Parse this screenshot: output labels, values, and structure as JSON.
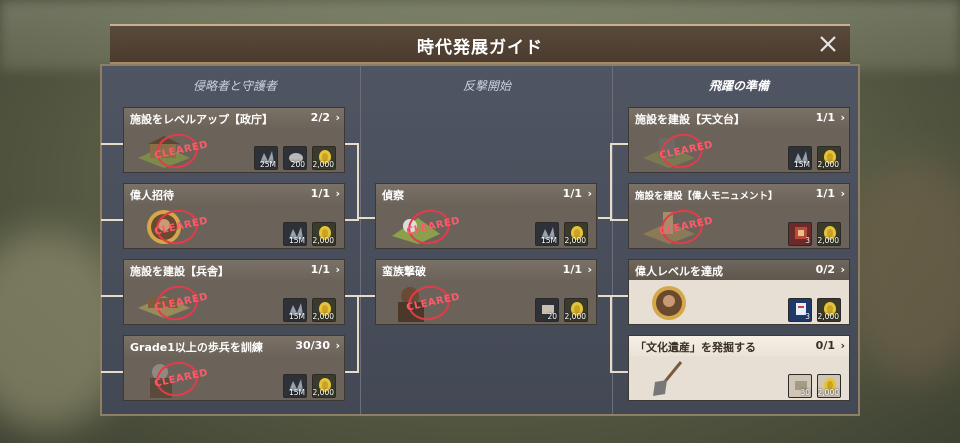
{
  "window": {
    "title": "時代発展ガイド"
  },
  "columns": [
    {
      "title": "侵略者と守護者",
      "active": false
    },
    {
      "title": "反撃開始",
      "active": false
    },
    {
      "title": "飛躍の準備",
      "active": true
    }
  ],
  "stamp_text": "CLEARED",
  "cards": {
    "c1": {
      "label": "施設をレベルアップ【政庁】",
      "progress": "2/2",
      "chevron": "›",
      "rewards": [
        "25M",
        "200",
        "2,000"
      ]
    },
    "c2": {
      "label": "偉人招待",
      "progress": "1/1",
      "chevron": "›",
      "rewards": [
        "15M",
        "2,000"
      ]
    },
    "c3": {
      "label": "施設を建設【兵舎】",
      "progress": "1/1",
      "chevron": "›",
      "rewards": [
        "15M",
        "2,000"
      ]
    },
    "c4": {
      "label": "Grade1以上の歩兵を訓練",
      "progress": "30/30",
      "chevron": "›",
      "rewards": [
        "15M",
        "2,000"
      ]
    },
    "c5": {
      "label": "偵察",
      "progress": "1/1",
      "chevron": "›",
      "rewards": [
        "15M",
        "2,000"
      ]
    },
    "c6": {
      "label": "蛮族撃破",
      "progress": "1/1",
      "chevron": "›",
      "rewards": [
        "20",
        "2,000"
      ]
    },
    "c7": {
      "label": "施設を建設【天文台】",
      "progress": "1/1",
      "chevron": "›",
      "rewards": [
        "15M",
        "2,000"
      ]
    },
    "c8": {
      "label": "施設を建設【偉人モニュメント】",
      "progress": "1/1",
      "chevron": "›",
      "rewards": [
        "3",
        "2,000"
      ]
    },
    "c9": {
      "label": "偉人レベルを達成",
      "progress": "0/2",
      "chevron": "›",
      "rewards": [
        "3",
        "2,000"
      ]
    },
    "c10": {
      "label": "「文化遺産」を発掘する",
      "progress": "0/1",
      "chevron": "›",
      "rewards": [
        "30",
        "2,000"
      ]
    }
  },
  "colors": {
    "stamp": "#e33b4a",
    "panel": "#4b505c",
    "frame": "#8f7e63"
  }
}
